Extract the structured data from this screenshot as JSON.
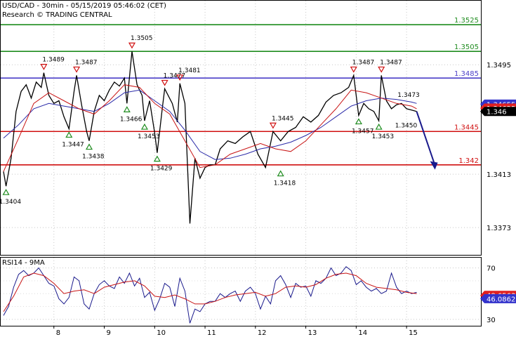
{
  "header": {
    "title": "USD/CAD - 30min - 05/15/2019 05:46:02 (CET)",
    "subtitle": "Research © TRADING CENTRAL"
  },
  "chart_data": [
    {
      "type": "line",
      "title": "USD/CAD - 30min - 05/15/2019 05:46:02 (CET)",
      "x_ticks": [
        "8",
        "9",
        "10",
        "11",
        "12",
        "13",
        "14",
        "15"
      ],
      "y_ticks": [
        "1.3495",
        "1.3413",
        "1.3373"
      ],
      "ylim": [
        1.3352,
        1.3543
      ],
      "grid": true,
      "levels": [
        {
          "label": "1.3525",
          "value": 1.3525,
          "color": "#1f8c1f"
        },
        {
          "label": "1.3505",
          "value": 1.3505,
          "color": "#1f8c1f"
        },
        {
          "label": "1.3485",
          "value": 1.3485,
          "color": "#4b3fc8"
        },
        {
          "label": "1.3445",
          "value": 1.3445,
          "color": "#d01010"
        },
        {
          "label": "1.342",
          "value": 1.342,
          "color": "#d01010"
        }
      ],
      "price_badges": [
        {
          "label": "1.34655",
          "value": 1.34655,
          "color": "#3333cc"
        },
        {
          "label": "1.34625",
          "value": 1.34625,
          "color": "#e02020"
        },
        {
          "label": "1.346",
          "value": 1.346,
          "color": "#000000"
        }
      ],
      "annotations": [
        {
          "label": "1.3404",
          "x": 7.05,
          "value": 1.3404,
          "type": "low"
        },
        {
          "label": "1.3489",
          "x": 7.8,
          "value": 1.3489,
          "type": "high"
        },
        {
          "label": "1.3447",
          "x": 8.3,
          "value": 1.3447,
          "type": "low"
        },
        {
          "label": "1.3487",
          "x": 8.45,
          "value": 1.3487,
          "type": "high"
        },
        {
          "label": "1.3438",
          "x": 8.7,
          "value": 1.3438,
          "type": "low"
        },
        {
          "label": "1.3466",
          "x": 9.45,
          "value": 1.3466,
          "type": "low"
        },
        {
          "label": "1.3505",
          "x": 9.55,
          "value": 1.3505,
          "type": "high"
        },
        {
          "label": "1.3453",
          "x": 9.8,
          "value": 1.3453,
          "type": "low"
        },
        {
          "label": "1.3429",
          "x": 10.05,
          "value": 1.3429,
          "type": "low"
        },
        {
          "label": "1.3477",
          "x": 10.2,
          "value": 1.3477,
          "type": "high"
        },
        {
          "label": "1.3481",
          "x": 10.5,
          "value": 1.3481,
          "type": "high"
        },
        {
          "label": "1.3445",
          "x": 12.35,
          "value": 1.3445,
          "type": "high"
        },
        {
          "label": "1.3418",
          "x": 12.5,
          "value": 1.3418,
          "type": "low"
        },
        {
          "label": "1.3487",
          "x": 13.95,
          "value": 1.3487,
          "type": "high"
        },
        {
          "label": "1.3457",
          "x": 14.05,
          "value": 1.3457,
          "type": "low"
        },
        {
          "label": "1.3453",
          "x": 14.45,
          "value": 1.3453,
          "type": "low"
        },
        {
          "label": "1.3487",
          "x": 14.5,
          "value": 1.3487,
          "type": "high"
        },
        {
          "label": "1.3473",
          "x": 15.1,
          "value": 1.3473,
          "type": "text"
        },
        {
          "label": "1.3450",
          "x": 15.05,
          "value": 1.345,
          "type": "text"
        }
      ],
      "series": [
        {
          "name": "USD/CAD",
          "x": [
            7.0,
            7.05,
            7.15,
            7.25,
            7.35,
            7.45,
            7.55,
            7.65,
            7.75,
            7.8,
            7.9,
            8.0,
            8.1,
            8.2,
            8.3,
            8.4,
            8.45,
            8.55,
            8.65,
            8.7,
            8.8,
            8.9,
            9.0,
            9.1,
            9.2,
            9.3,
            9.4,
            9.45,
            9.55,
            9.65,
            9.75,
            9.8,
            9.9,
            10.0,
            10.05,
            10.15,
            10.2,
            10.35,
            10.45,
            10.5,
            10.6,
            10.7,
            10.8,
            10.9,
            11.0,
            11.1,
            11.2,
            11.3,
            11.45,
            11.6,
            11.75,
            11.9,
            12.05,
            12.2,
            12.35,
            12.5,
            12.65,
            12.8,
            12.95,
            13.1,
            13.25,
            13.4,
            13.55,
            13.7,
            13.85,
            13.95,
            14.05,
            14.15,
            14.25,
            14.35,
            14.45,
            14.5,
            14.6,
            14.7,
            14.8,
            14.9,
            15.0,
            15.1,
            15.2
          ],
          "values": [
            1.3415,
            1.3404,
            1.3425,
            1.346,
            1.3475,
            1.348,
            1.347,
            1.3482,
            1.3478,
            1.3489,
            1.3472,
            1.3466,
            1.3468,
            1.3456,
            1.3447,
            1.3475,
            1.3487,
            1.3465,
            1.3445,
            1.3438,
            1.346,
            1.3472,
            1.3468,
            1.3476,
            1.3482,
            1.3479,
            1.3485,
            1.3466,
            1.3505,
            1.348,
            1.3472,
            1.3453,
            1.3468,
            1.3444,
            1.3429,
            1.3462,
            1.3477,
            1.3466,
            1.3452,
            1.3481,
            1.3466,
            1.3376,
            1.3425,
            1.341,
            1.3418,
            1.342,
            1.342,
            1.3432,
            1.3438,
            1.3436,
            1.3441,
            1.3445,
            1.3428,
            1.3418,
            1.3445,
            1.3438,
            1.3445,
            1.3448,
            1.3456,
            1.3452,
            1.3457,
            1.3467,
            1.3472,
            1.3474,
            1.3478,
            1.3487,
            1.3457,
            1.3466,
            1.3462,
            1.346,
            1.3453,
            1.3487,
            1.3468,
            1.3462,
            1.3465,
            1.3466,
            1.3462,
            1.3461,
            1.346
          ]
        },
        {
          "name": "",
          "x": [
            7.0,
            7.3,
            7.6,
            7.9,
            8.2,
            8.5,
            8.8,
            9.1,
            9.4,
            9.7,
            10.0,
            10.3,
            10.6,
            10.9,
            11.2,
            11.5,
            11.8,
            12.1,
            12.4,
            12.7,
            13.0,
            13.3,
            13.6,
            13.9,
            14.2,
            14.5,
            14.8,
            15.1,
            15.2
          ],
          "values": [
            1.344,
            1.345,
            1.3462,
            1.3466,
            1.3464,
            1.3462,
            1.346,
            1.3466,
            1.3474,
            1.3476,
            1.3468,
            1.346,
            1.3446,
            1.343,
            1.3424,
            1.3425,
            1.3428,
            1.3432,
            1.3434,
            1.3437,
            1.3442,
            1.3448,
            1.3456,
            1.3464,
            1.3468,
            1.347,
            1.3469,
            1.3467,
            1.3466
          ]
        },
        {
          "name": "",
          "x": [
            7.0,
            7.3,
            7.6,
            7.9,
            8.2,
            8.5,
            8.8,
            9.1,
            9.4,
            9.7,
            10.0,
            10.3,
            10.6,
            10.9,
            11.2,
            11.5,
            11.8,
            12.1,
            12.4,
            12.7,
            13.0,
            13.3,
            13.6,
            13.9,
            14.2,
            14.5,
            14.8,
            15.1,
            15.2
          ],
          "values": [
            1.3415,
            1.344,
            1.3466,
            1.3474,
            1.3468,
            1.3462,
            1.3458,
            1.3468,
            1.348,
            1.3478,
            1.3466,
            1.3458,
            1.3438,
            1.3418,
            1.342,
            1.3428,
            1.3432,
            1.3436,
            1.3432,
            1.343,
            1.3438,
            1.345,
            1.3462,
            1.3476,
            1.3474,
            1.347,
            1.3466,
            1.3464,
            1.3462
          ]
        }
      ],
      "projection": {
        "from_x": 15.2,
        "from_value": 1.346,
        "to_x": 15.55,
        "to_value": 1.3418
      }
    },
    {
      "type": "line",
      "title": "RSI14 - 9MA",
      "y_ticks": [
        "70",
        "30"
      ],
      "ylim": [
        25,
        78
      ],
      "grid": true,
      "value_badges": [
        {
          "label": "48.6563",
          "value": 48.6563,
          "color": "#e02020"
        },
        {
          "label": "46.0862",
          "value": 46.0862,
          "color": "#3333cc"
        }
      ],
      "series": [
        {
          "name": "RSI14",
          "x": [
            7.0,
            7.1,
            7.2,
            7.3,
            7.4,
            7.5,
            7.6,
            7.7,
            7.8,
            7.9,
            8.0,
            8.1,
            8.2,
            8.3,
            8.4,
            8.5,
            8.6,
            8.7,
            8.8,
            8.9,
            9.0,
            9.1,
            9.2,
            9.3,
            9.4,
            9.5,
            9.6,
            9.7,
            9.8,
            9.9,
            10.0,
            10.1,
            10.2,
            10.3,
            10.4,
            10.5,
            10.6,
            10.7,
            10.8,
            10.9,
            11.0,
            11.1,
            11.2,
            11.3,
            11.4,
            11.5,
            11.6,
            11.7,
            11.8,
            11.9,
            12.0,
            12.1,
            12.2,
            12.3,
            12.4,
            12.5,
            12.6,
            12.7,
            12.8,
            12.9,
            13.0,
            13.1,
            13.2,
            13.3,
            13.4,
            13.5,
            13.6,
            13.7,
            13.8,
            13.9,
            14.0,
            14.1,
            14.2,
            14.3,
            14.4,
            14.5,
            14.6,
            14.7,
            14.8,
            14.9,
            15.0,
            15.1,
            15.2
          ],
          "values": [
            33,
            40,
            55,
            65,
            68,
            64,
            66,
            70,
            64,
            58,
            56,
            46,
            42,
            47,
            63,
            60,
            42,
            38,
            50,
            57,
            60,
            56,
            54,
            63,
            58,
            66,
            56,
            62,
            47,
            51,
            37,
            46,
            58,
            55,
            40,
            62,
            52,
            27,
            38,
            36,
            42,
            44,
            44,
            50,
            47,
            50,
            52,
            44,
            52,
            55,
            50,
            38,
            48,
            42,
            60,
            64,
            57,
            47,
            58,
            55,
            56,
            48,
            60,
            58,
            62,
            70,
            64,
            66,
            71,
            68,
            57,
            60,
            55,
            52,
            54,
            50,
            52,
            66,
            55,
            50,
            52,
            50,
            51
          ]
        },
        {
          "name": "9MA",
          "x": [
            7.0,
            7.2,
            7.4,
            7.6,
            7.8,
            8.0,
            8.2,
            8.4,
            8.6,
            8.8,
            9.0,
            9.2,
            9.4,
            9.6,
            9.8,
            10.0,
            10.2,
            10.4,
            10.6,
            10.8,
            11.0,
            11.2,
            11.4,
            11.6,
            11.8,
            12.0,
            12.2,
            12.4,
            12.6,
            12.8,
            13.0,
            13.2,
            13.4,
            13.6,
            13.8,
            14.0,
            14.2,
            14.4,
            14.6,
            14.8,
            15.0,
            15.2
          ],
          "values": [
            36,
            48,
            63,
            66,
            64,
            58,
            50,
            52,
            53,
            50,
            55,
            57,
            59,
            60,
            56,
            48,
            47,
            49,
            46,
            42,
            42,
            44,
            47,
            49,
            50,
            51,
            48,
            50,
            55,
            56,
            55,
            57,
            62,
            65,
            66,
            64,
            58,
            55,
            54,
            53,
            51,
            50
          ]
        }
      ]
    }
  ]
}
